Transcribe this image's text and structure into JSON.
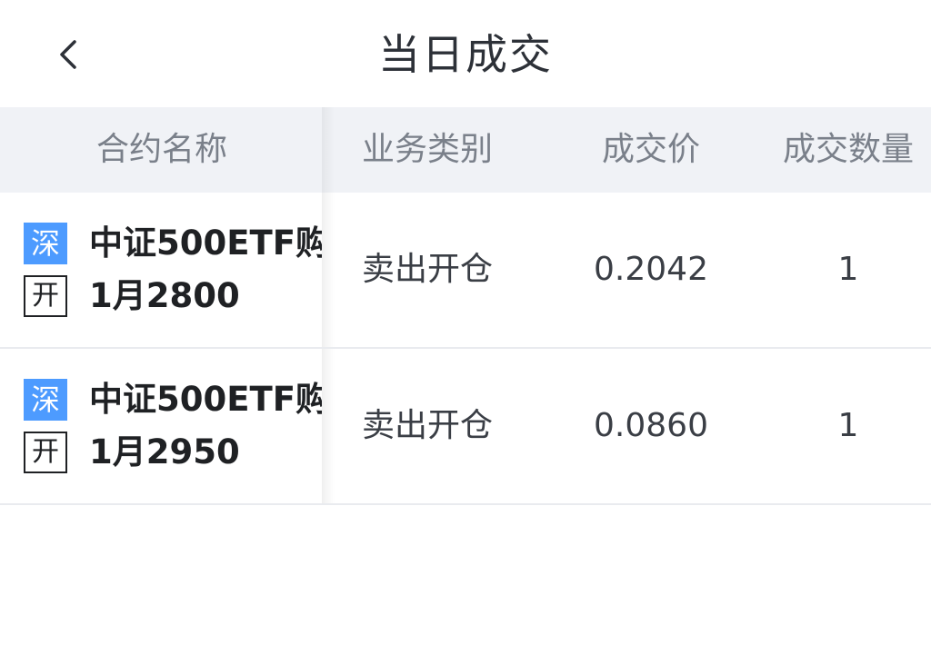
{
  "header": {
    "title": "当日成交",
    "back_icon": "chevron-left-icon"
  },
  "table": {
    "columns": [
      "合约名称",
      "业务类别",
      "成交价",
      "成交数量"
    ],
    "rows": [
      {
        "exchange_badge": "深",
        "open_badge": "开",
        "name_line1": "中证500ETF购",
        "name_line2": "1月2800",
        "type": "卖出开仓",
        "price": "0.2042",
        "quantity": "1"
      },
      {
        "exchange_badge": "深",
        "open_badge": "开",
        "name_line1": "中证500ETF购",
        "name_line2": "1月2950",
        "type": "卖出开仓",
        "price": "0.0860",
        "quantity": "1"
      }
    ]
  },
  "colors": {
    "exchange_badge_bg": "#4d9bff",
    "header_bg": "#f0f2f6",
    "title_text": "#2d3138",
    "column_header_text": "#7a808a"
  }
}
